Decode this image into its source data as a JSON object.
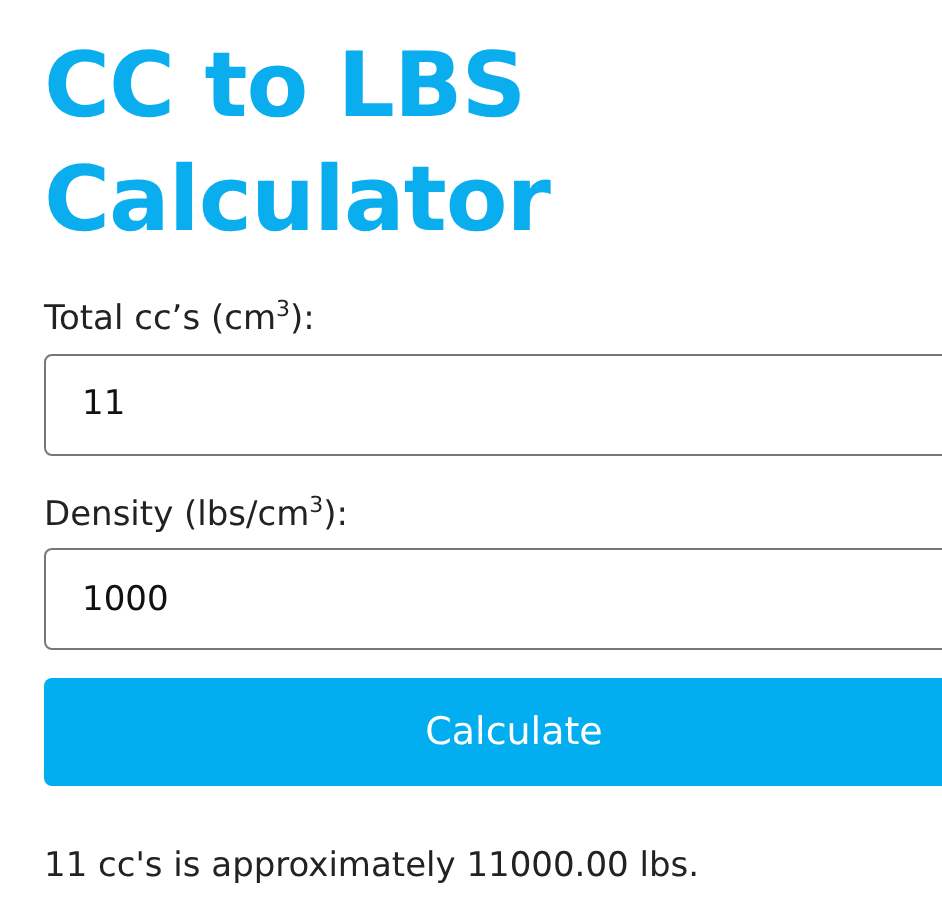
{
  "title": "CC to LBS Calculator",
  "fields": [
    {
      "label": "Total cc’s (cm$^{3}$):",
      "value": "11"
    },
    {
      "label": "Density (lbs/cm$^{3}$):",
      "value": "1000"
    }
  ],
  "button": "Calculate",
  "result": "11 cc's is approximately 11000.00 lbs."
}
